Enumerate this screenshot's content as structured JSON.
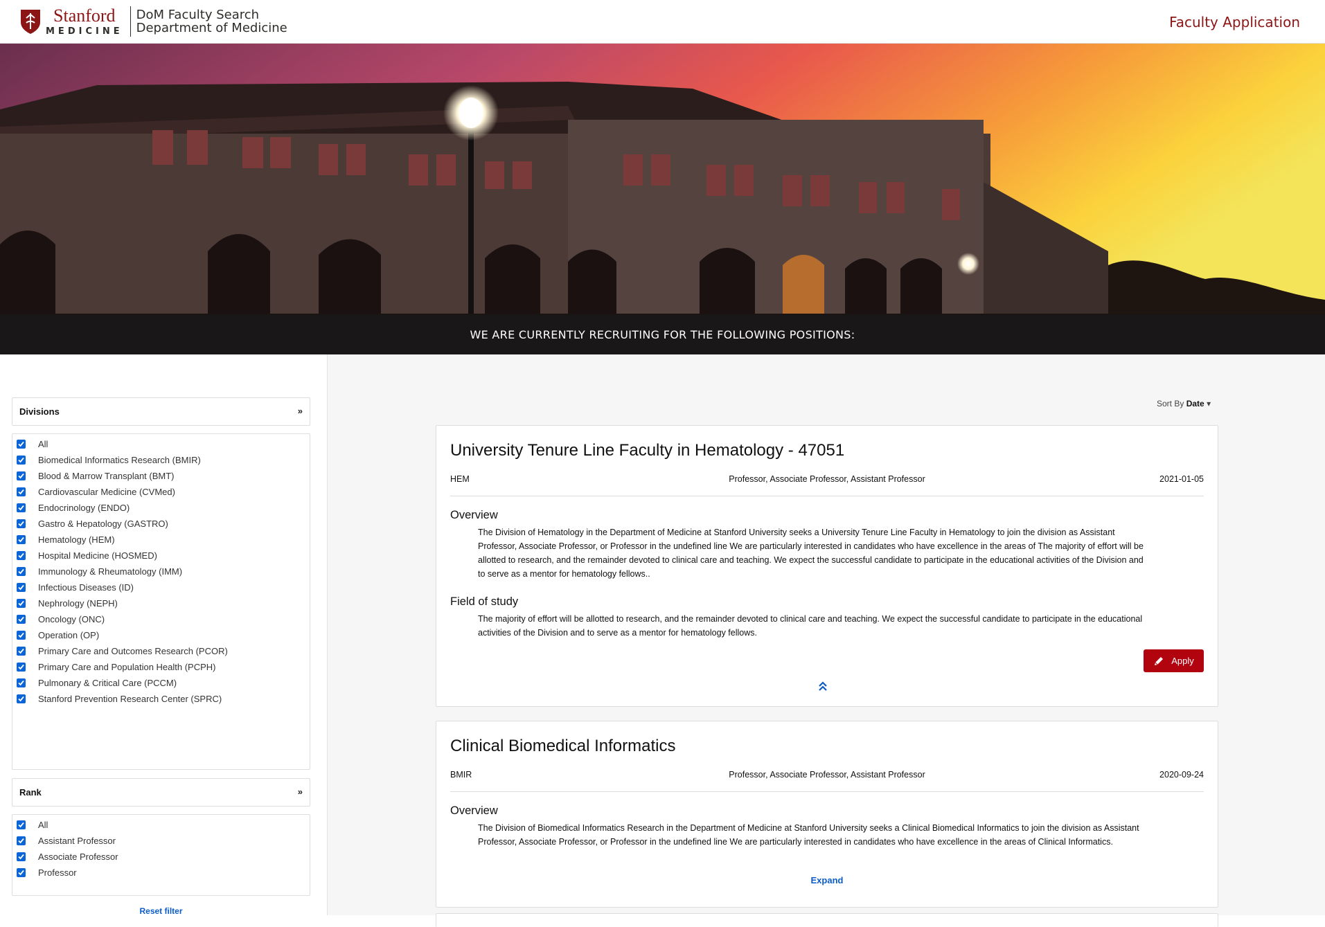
{
  "header": {
    "logo_wordmark": "Stanford",
    "logo_sub": "MEDICINE",
    "site_title": "DoM Faculty Search",
    "site_subtitle": "Department of Medicine",
    "nav_link": "Faculty Application"
  },
  "hero": {
    "banner_text": "WE ARE CURRENTLY RECRUITING FOR THE FOLLOWING POSITIONS:"
  },
  "sidebar": {
    "divisions": {
      "title": "Divisions",
      "options": [
        {
          "label": "All",
          "checked": true
        },
        {
          "label": "Biomedical Informatics Research (BMIR)",
          "checked": true
        },
        {
          "label": "Blood & Marrow Transplant (BMT)",
          "checked": true
        },
        {
          "label": "Cardiovascular Medicine (CVMed)",
          "checked": true
        },
        {
          "label": "Endocrinology (ENDO)",
          "checked": true
        },
        {
          "label": "Gastro & Hepatology (GASTRO)",
          "checked": true
        },
        {
          "label": "Hematology (HEM)",
          "checked": true
        },
        {
          "label": "Hospital Medicine (HOSMED)",
          "checked": true
        },
        {
          "label": "Immunology & Rheumatology (IMM)",
          "checked": true
        },
        {
          "label": "Infectious Diseases (ID)",
          "checked": true
        },
        {
          "label": "Nephrology (NEPH)",
          "checked": true
        },
        {
          "label": "Oncology (ONC)",
          "checked": true
        },
        {
          "label": "Operation (OP)",
          "checked": true
        },
        {
          "label": "Primary Care and Outcomes Research (PCOR)",
          "checked": true
        },
        {
          "label": "Primary Care and Population Health (PCPH)",
          "checked": true
        },
        {
          "label": "Pulmonary & Critical Care (PCCM)",
          "checked": true
        },
        {
          "label": "Stanford Prevention Research Center (SPRC)",
          "checked": true
        }
      ]
    },
    "rank": {
      "title": "Rank",
      "options": [
        {
          "label": "All",
          "checked": true
        },
        {
          "label": "Assistant Professor",
          "checked": true
        },
        {
          "label": "Associate Professor",
          "checked": true
        },
        {
          "label": "Professor",
          "checked": true
        }
      ]
    },
    "reset_label": "Reset filter"
  },
  "main": {
    "sort_label": "Sort By",
    "sort_value": "Date",
    "jobs": [
      {
        "title": "University Tenure Line Faculty in Hematology - 47051",
        "division": "HEM",
        "ranks": "Professor, Associate Professor, Assistant Professor",
        "date": "2021-01-05",
        "overview_heading": "Overview",
        "overview_lines": [
          "The Division of Hematology in the Department of Medicine at Stanford University seeks a University Tenure Line Faculty in Hematology to join the division as Assistant",
          "Professor, Associate Professor, or Professor in the undefined line We are particularly interested in candidates who have excellence in the areas of The majority of effort will be",
          "allotted to research, and the remainder devoted to clinical care and teaching. We expect the successful candidate to participate in the educational activities of the Division and",
          "to serve as a mentor for hematology fellows.."
        ],
        "field_heading": "Field of study",
        "field_lines": [
          "The majority of effort will be allotted to research, and the remainder devoted to clinical care and teaching. We expect the successful candidate to participate in the educational",
          "activities of the Division and to serve as a mentor for hematology fellows."
        ],
        "apply_label": "Apply"
      },
      {
        "title": "Clinical Biomedical Informatics",
        "division": "BMIR",
        "ranks": "Professor, Associate Professor, Assistant Professor",
        "date": "2020-09-24",
        "overview_heading": "Overview",
        "overview_lines": [
          "The Division of Biomedical Informatics Research in the Department of Medicine at Stanford University seeks a Clinical Biomedical Informatics to join the division as Assistant",
          "Professor, Associate Professor, or Professor in the undefined line We are particularly interested in candidates who have excellence in the areas of Clinical Informatics."
        ],
        "expand_label": "Expand"
      }
    ]
  },
  "colors": {
    "brand_red": "#8c1515",
    "button_red": "#b1040e",
    "link_blue": "#0b5cc7",
    "checkbox_blue": "#0a66d8"
  },
  "icons": {
    "logo": "stanford-shield-icon",
    "division_toggle": "chevron-double-down-icon",
    "apply": "pencil-icon",
    "collapse": "chevron-double-up-icon",
    "sort": "caret-down-icon"
  }
}
